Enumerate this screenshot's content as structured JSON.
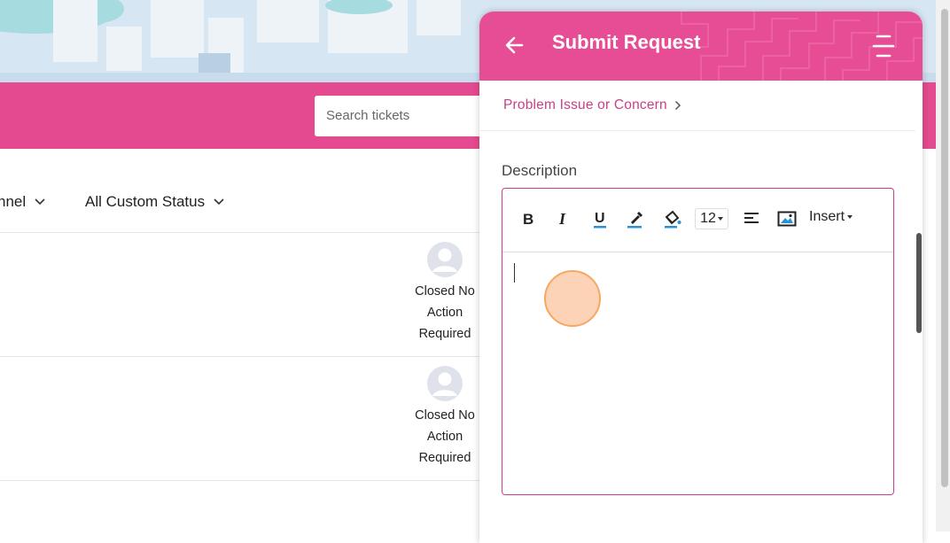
{
  "background": {
    "search": {
      "placeholder": "Search tickets"
    },
    "filters": [
      {
        "label": "nnel"
      },
      {
        "label": "All Custom Status"
      }
    ],
    "rows": [
      {
        "status_lines": [
          "Closed No",
          "Action",
          "Required"
        ]
      },
      {
        "status_lines": [
          "Closed No",
          "Action",
          "Required"
        ]
      }
    ],
    "colors": {
      "brand_pink": "#e44a8f"
    }
  },
  "panel": {
    "title": "Submit Request",
    "breadcrumb": "Problem Issue or Concern",
    "description_label": "Description",
    "editor": {
      "font_size": "12",
      "insert_label": "Insert",
      "content": ""
    },
    "icons": {
      "back": "arrow-left-icon",
      "menu": "menu-icon",
      "bold": "bold-icon",
      "italic": "italic-icon",
      "underline": "underline-icon",
      "text_color": "text-color-icon",
      "bg_color": "paint-bucket-icon",
      "align": "align-left-icon",
      "image": "image-icon"
    },
    "colors": {
      "header": "#e74d94",
      "accent": "#cc3f86"
    }
  }
}
